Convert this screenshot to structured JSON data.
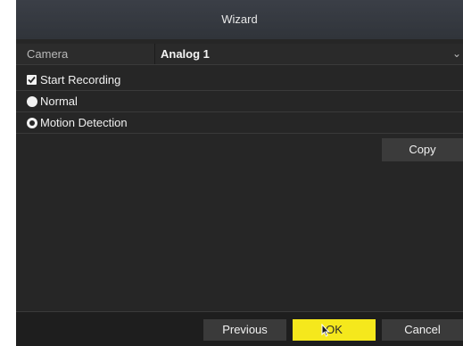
{
  "window": {
    "title": "Wizard"
  },
  "camera": {
    "label": "Camera",
    "value": "Analog 1"
  },
  "options": {
    "start_recording": {
      "label": "Start Recording",
      "checked": true
    },
    "normal": {
      "label": "Normal",
      "selected": false
    },
    "motion_detection": {
      "label": "Motion Detection",
      "selected": true
    }
  },
  "actions": {
    "copy_label": "Copy"
  },
  "footer": {
    "previous_label": "Previous",
    "ok_label": "OK",
    "cancel_label": "Cancel"
  },
  "colors": {
    "accent": "#f5e81c",
    "background": "#262626",
    "titlebar": "#353940"
  },
  "icons": {
    "checkbox": "checkmark-icon",
    "radio": "radio-icon",
    "dropdown": "chevron-down-icon",
    "cursor": "mouse-pointer-icon"
  }
}
